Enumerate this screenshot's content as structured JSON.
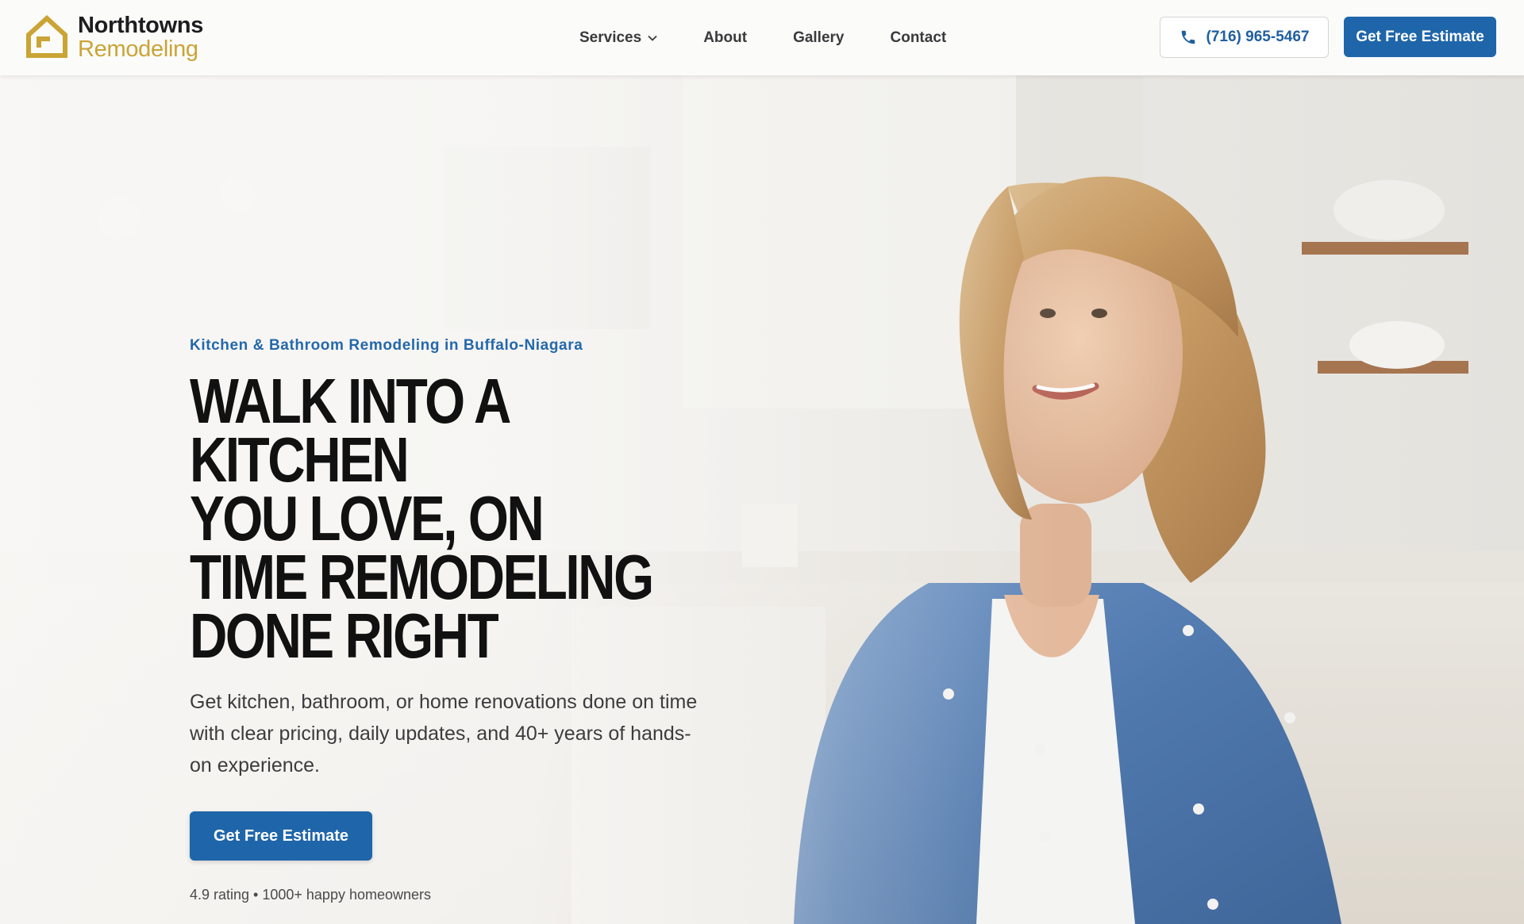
{
  "brand": {
    "name_line1": "Northtowns",
    "name_line2": "Remodeling"
  },
  "nav": {
    "items": [
      {
        "label": "Services",
        "has_dropdown": true
      },
      {
        "label": "About"
      },
      {
        "label": "Gallery"
      },
      {
        "label": "Contact"
      }
    ]
  },
  "header": {
    "phone": "(716) 965-5467",
    "cta_label": "Get Free Estimate"
  },
  "hero": {
    "eyebrow": "Kitchen & Bathroom Remodeling in Buffalo-Niagara",
    "headline_lines": [
      "WALK INTO A KITCHEN",
      "YOU LOVE, ON",
      "TIME REMODELING",
      "DONE RIGHT"
    ],
    "subtext": "Get kitchen, bathroom, or home renovations done on time with clear pricing, daily updates, and 40+ years of hands-on experience.",
    "cta_label": "Get Free Estimate",
    "rating_text": "4.9 rating • 1000+ happy homeowners"
  },
  "colors": {
    "brand_gold": "#caa435",
    "primary_blue": "#1f65aa",
    "accent_blue": "#2468ab",
    "text_dark": "#111111"
  },
  "icons": {
    "logo": "house-logo-icon",
    "phone": "phone-icon",
    "dropdown": "chevron-down-icon"
  }
}
